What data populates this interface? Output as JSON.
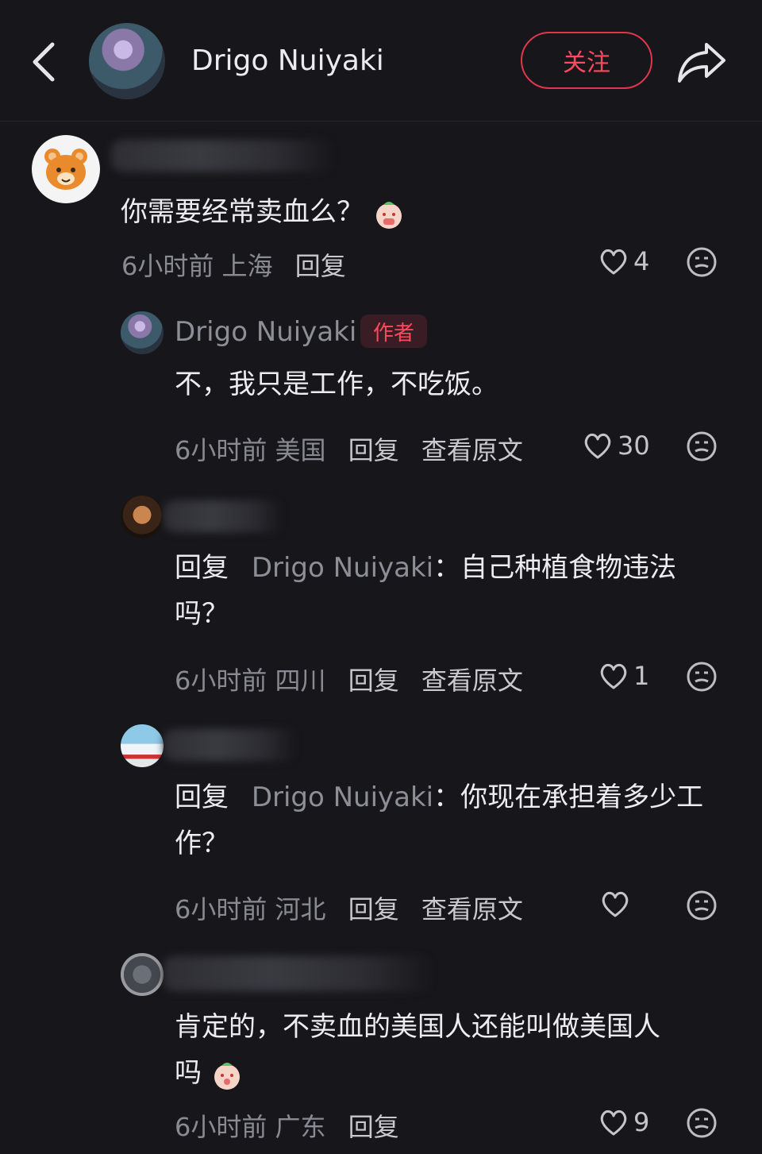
{
  "header": {
    "title": "Drigo Nuiyaki",
    "follow_label": "关注"
  },
  "comments": [
    {
      "text": "你需要经常卖血么？",
      "time": "6小时前",
      "location": "上海",
      "reply_label": "回复",
      "likes": "4"
    },
    {
      "name": "Drigo Nuiyaki",
      "badge": "作者",
      "text": "不，我只是工作，不吃饭。",
      "time": "6小时前",
      "location": "美国",
      "reply_label": "回复",
      "original_label": "查看原文",
      "likes": "30"
    },
    {
      "reply_prefix": "回复",
      "reply_to": "Drigo Nuiyaki",
      "colon": "：",
      "text_line1": "自己种植食物违法",
      "text_line2": "吗？",
      "time": "6小时前",
      "location": "四川",
      "reply_label": "回复",
      "original_label": "查看原文",
      "likes": "1"
    },
    {
      "reply_prefix": "回复",
      "reply_to": "Drigo Nuiyaki",
      "colon": "：",
      "text_line1": "你现在承担着多少工",
      "text_line2": "作？",
      "time": "6小时前",
      "location": "河北",
      "reply_label": "回复",
      "original_label": "查看原文",
      "likes": ""
    },
    {
      "text_line1": "肯定的，不卖血的美国人还能叫做美国人",
      "text_line2": "吗",
      "time": "6小时前",
      "location": "广东",
      "reply_label": "回复",
      "likes": "9"
    }
  ],
  "colors": {
    "background": "#17171b",
    "accent": "#ff4a5d",
    "muted": "#8a8a92"
  }
}
